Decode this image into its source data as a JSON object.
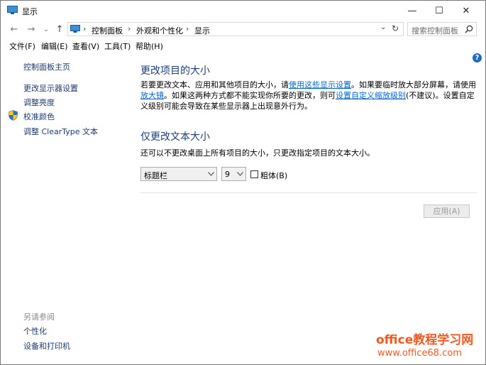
{
  "window": {
    "title": "显示",
    "controls": {
      "minimize": "—",
      "maximize": "☐",
      "close": "✕"
    }
  },
  "nav": {
    "back": "←",
    "forward": "→",
    "recent": "⌄",
    "up": "↑",
    "breadcrumb": [
      "控制面板",
      "外观和个性化",
      "显示"
    ],
    "separator": "›",
    "dropdown": "⌄",
    "refresh": "↻"
  },
  "search": {
    "placeholder": "搜索控制面板"
  },
  "menu": [
    "文件(F)",
    "编辑(E)",
    "查看(V)",
    "工具(T)",
    "帮助(H)"
  ],
  "help": {
    "label": "?"
  },
  "sidebar": {
    "home": "控制面板主页",
    "links": [
      "更改显示器设置",
      "调整亮度",
      "校准颜色",
      "调整 ClearType 文本"
    ],
    "see_also_title": "另请参阅",
    "see_also": [
      "个性化",
      "设备和打印机"
    ]
  },
  "main": {
    "section1_title": "更改项目的大小",
    "para_1": "若要更改文本、应用和其他项目的大小，请",
    "para_link1": "使用这些显示设置",
    "para_2": "。如果要临时放大部分屏幕，请使用",
    "para_link2": "放大镜",
    "para_3": "。如果这两种方式都不能实现你所要的更改，则可",
    "para_link3": "设置自定义缩放级别",
    "para_4": "(不建议)。设置自定义级别可能会导致在某些显示器上出现意外行为。",
    "section2_title": "仅更改文本大小",
    "section2_desc": "还可以不更改桌面上所有项目的大小，只更改指定项目的文本大小。",
    "item_select": "标题栏",
    "size_select": "9",
    "bold_label": "粗体(B)",
    "bold_checked": false,
    "apply_label": "应用(A)"
  },
  "watermark": {
    "line1": "office教程学习网",
    "line2": "www.office68.com"
  },
  "colors": {
    "link": "#0066cc",
    "heading": "#1d3d7b",
    "watermark": "#f05a22"
  }
}
